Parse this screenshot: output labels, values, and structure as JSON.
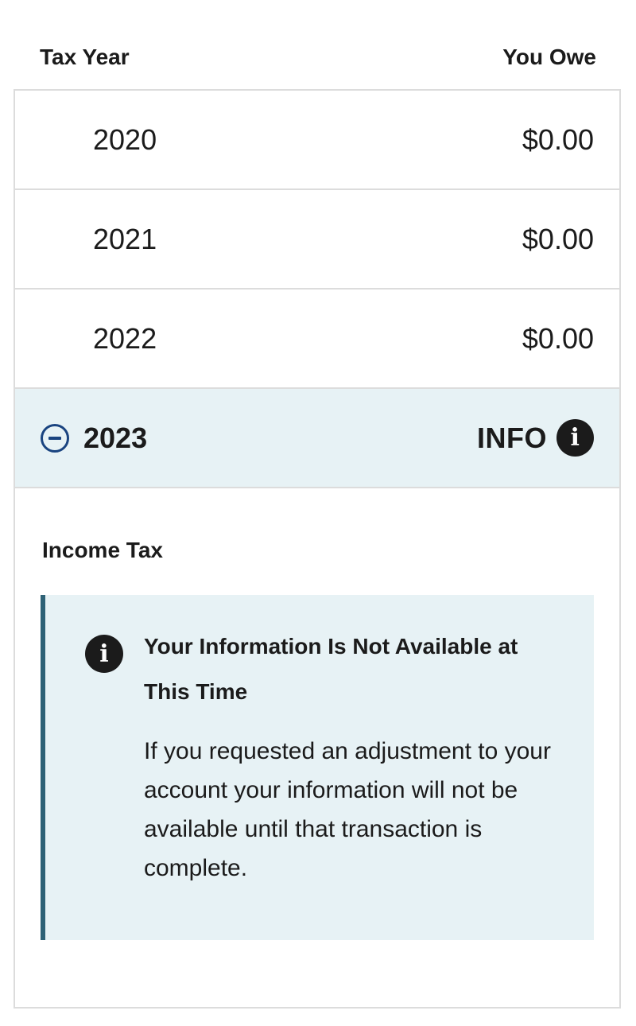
{
  "header": {
    "tax_year_label": "Tax Year",
    "you_owe_label": "You Owe"
  },
  "rows": [
    {
      "year": "2020",
      "amount": "$0.00"
    },
    {
      "year": "2021",
      "amount": "$0.00"
    },
    {
      "year": "2022",
      "amount": "$0.00"
    }
  ],
  "expanded_row": {
    "year": "2023",
    "status": "INFO",
    "icon": "info-icon",
    "toggle_icon": "collapse-minus-icon"
  },
  "detail": {
    "section_title": "Income Tax",
    "alert": {
      "icon": "info-icon",
      "heading": "Your Information Is Not Available at This Time",
      "body": "If you requested an adjustment to your account your information will not be available until that transaction is complete."
    }
  },
  "colors": {
    "text": "#1b1b1b",
    "border": "#dcdcdc",
    "highlight_bg": "#e7f2f5",
    "alert_accent": "#2e6276",
    "toggle_icon": "#1a4480"
  }
}
